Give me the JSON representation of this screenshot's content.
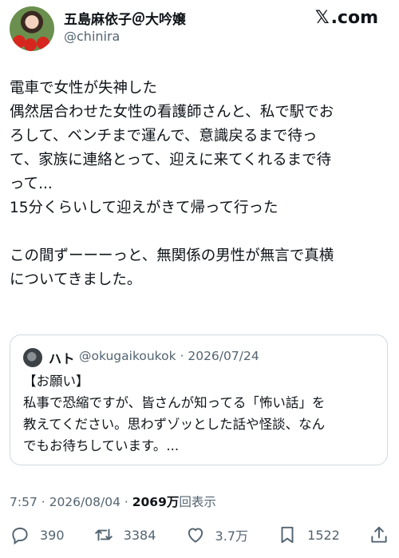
{
  "author": {
    "name": "五島麻依子＠大吟嬢",
    "handle": "@chinira"
  },
  "brand": {
    "x": "𝕏",
    "domain": ".com"
  },
  "post": {
    "lines": [
      "電車で女性が失神した",
      "偶然居合わせた女性の看護師さんと、私で駅でお",
      "ろして、ベンチまで運んで、意識戻るまで待っ",
      "て、家族に連絡とって、迎えに来てくれるまで待",
      "って...",
      "15分くらいして迎えがきて帰って行った",
      "",
      "この間ずーーーっと、無関係の男性が無言で真横",
      "についてきました。"
    ]
  },
  "quote": {
    "name": "ハト",
    "handle_date": "@okugaikoukok · 2026/07/24",
    "lines": [
      "【お願い】",
      "私事で恐縮ですが、皆さんが知ってる「怖い話」を",
      "教えてください。思わずゾッとした話や怪談、なん",
      "でもお待ちしています。..."
    ]
  },
  "meta": {
    "time_date": "7:57 · 2026/08/04 · ",
    "views": "2069万",
    "views_label": "回表示"
  },
  "actions": {
    "replies": "390",
    "reposts": "3384",
    "likes": "3.7万",
    "bookmarks": "1522"
  },
  "colors": {
    "text": "#0f1419",
    "secondary": "#536471",
    "border": "#cfd9de"
  }
}
